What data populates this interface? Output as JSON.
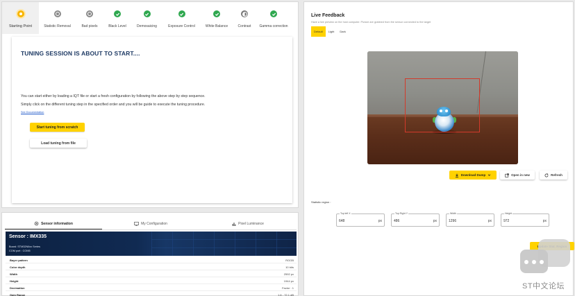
{
  "stepper": {
    "steps": [
      {
        "label": "Starting Point",
        "state": "current"
      },
      {
        "label": "Statistic Removal",
        "state": "pending"
      },
      {
        "label": "Bad pixels",
        "state": "pending"
      },
      {
        "label": "Black Level",
        "state": "done"
      },
      {
        "label": "Demosaicing",
        "state": "done"
      },
      {
        "label": "Exposure Control",
        "state": "done"
      },
      {
        "label": "White Balance",
        "state": "done"
      },
      {
        "label": "Contrast",
        "state": "partial"
      },
      {
        "label": "Gamma correction",
        "state": "done"
      }
    ]
  },
  "intro": {
    "title": "TUNING SESSION IS ABOUT TO START....",
    "line1": "You can start either by loading a IQT file or start a fresh configuration by following the above step by step sequence.",
    "line2": "Simply click on the different tuning step in the specified order and you will be guide to execute the tuning procedure.",
    "link": "See Documentation",
    "start_button": "Start tuning from scratch",
    "load_button": "Load tuning from file"
  },
  "bottom_tabs": {
    "sensor": "Sensor information",
    "config": "My Configuration",
    "luminance": "Pixel Luminance"
  },
  "sensor": {
    "title": "Sensor : IMX335",
    "board": "Board: STM32N6xx Series",
    "com": "COM port : COM5",
    "rows": [
      {
        "key": "Bayer pattern",
        "value": "RGGB"
      },
      {
        "key": "Color depth",
        "value": "10 bits"
      },
      {
        "key": "Width",
        "value": "2592 px"
      },
      {
        "key": "Height",
        "value": "1944 px"
      },
      {
        "key": "Decimation",
        "value": "Factor : 1"
      },
      {
        "key": "Gain Range",
        "value": "1.6 - 72.1 dB"
      }
    ]
  },
  "live": {
    "title": "Live Feedback",
    "subtitle": "Have a live preview on the host computer. Picture are grabbed from the sensor connected to the target",
    "modes": [
      "Default",
      "Light",
      "Dark"
    ],
    "download": "Download Dump",
    "open_new": "Open in new",
    "refresh": "Refresh",
    "stat_label": "Statistic region :",
    "fields": [
      {
        "label": "Top left X",
        "value": "648",
        "unit": "px"
      },
      {
        "label": "Top Right Y",
        "value": "486",
        "unit": "px"
      },
      {
        "label": "Width",
        "value": "1296",
        "unit": "px"
      },
      {
        "label": "Height",
        "value": "972",
        "unit": "px"
      }
    ],
    "update_button": "Update Stat. Region"
  },
  "watermark": {
    "text": "ST中文论坛"
  },
  "colors": {
    "accent": "#ffd200",
    "step_current": "#f8b500",
    "step_done": "#2fa84f",
    "banner": "#0d2242",
    "roi": "#d23a2a"
  }
}
